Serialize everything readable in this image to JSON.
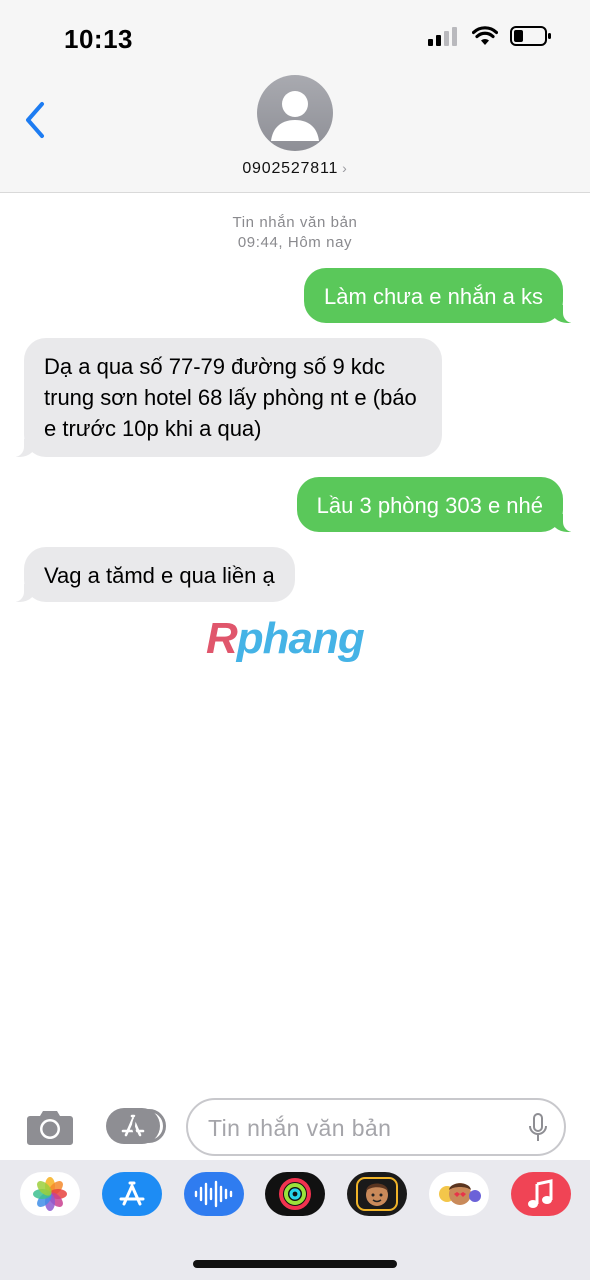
{
  "status": {
    "time": "10:13"
  },
  "header": {
    "contact": "0902527811",
    "contact_chevron": "›"
  },
  "thread": {
    "meta_label": "Tin nhắn văn bản",
    "meta_time": "09:44, Hôm nay",
    "messages": [
      {
        "direction": "outgoing",
        "text": "Làm chưa e nhắn a ks"
      },
      {
        "direction": "incoming",
        "text": "Dạ a qua số 77-79 đường số 9 kdc trung sơn hotel 68 lấy phòng nt e (báo e trước 10p khi a qua)"
      },
      {
        "direction": "outgoing",
        "text": "Lầu 3 phòng 303 e nhé"
      },
      {
        "direction": "incoming",
        "text": "Vag a tămd e qua liền ạ"
      }
    ]
  },
  "watermark": {
    "first": "R",
    "rest": "phang"
  },
  "composer": {
    "placeholder": "Tin nhắn văn bản"
  },
  "app_drawer": [
    "photos-icon",
    "app-store-icon",
    "audio-messages-icon",
    "activity-icon",
    "memoji-icon",
    "animoji-stickers-icon",
    "music-icon"
  ],
  "colors": {
    "outgoing": "#5ac85a",
    "incoming": "#e9e9eb",
    "accent": "#1d7cf2"
  }
}
